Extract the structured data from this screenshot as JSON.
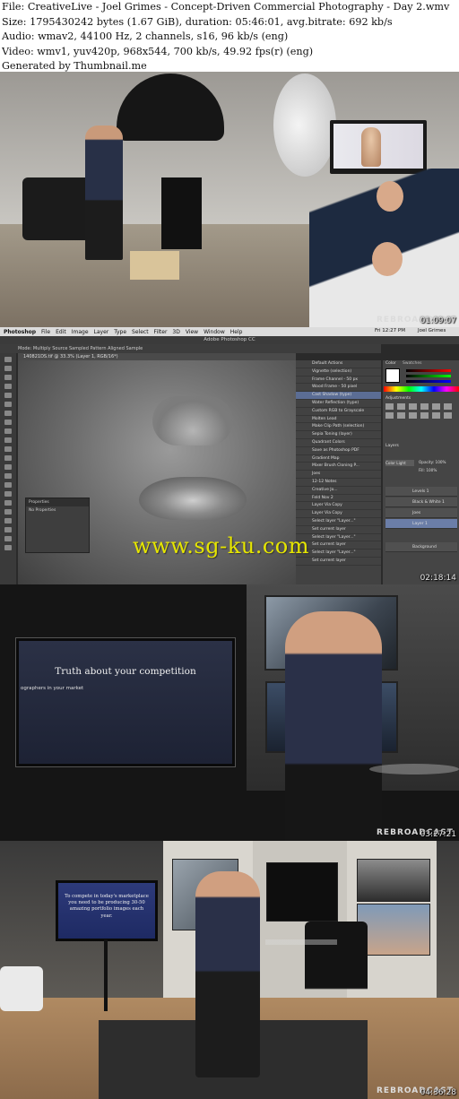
{
  "header": {
    "file_line": "File: CreativeLive - Joel Grimes - Concept-Driven Commercial Photography - Day 2.wmv",
    "size_line": "Size: 1795430242 bytes (1.67 GiB), duration: 05:46:01, avg.bitrate: 692 kb/s",
    "audio_line": "Audio: wmav2, 44100 Hz, 2 channels, s16, 96 kb/s (eng)",
    "video_line": "Video: wmv1, yuv420p, 968x544, 700 kb/s, 49.92 fps(r) (eng)",
    "generated_line": "Generated by Thumbnail.me"
  },
  "frames": [
    {
      "timestamp": "01:09:07",
      "watermark": "REBROADCAST"
    },
    {
      "timestamp": "02:18:14",
      "watermark": ""
    },
    {
      "timestamp": "03:27:21",
      "watermark": "REBROADCAST"
    },
    {
      "timestamp": "04:36:28",
      "watermark": "REBROADCAST"
    }
  ],
  "photoshop": {
    "menu": [
      "Photoshop",
      "File",
      "Edit",
      "Image",
      "Layer",
      "Type",
      "Select",
      "Filter",
      "3D",
      "View",
      "Window",
      "Help"
    ],
    "clock": "Fri 12:27 PM",
    "user": "Joel Grimes",
    "window_title": "Adobe Photoshop CC",
    "options_bar": "Mode: Multiply   Source   Sampled   Pattern   Aligned Sample",
    "doc_tab": "140821DS.tif @ 33.3% (Layer 1, RGB/16*)",
    "properties_title": "Properties",
    "properties_text": "No Properties",
    "actions": [
      "Default Actions",
      "Vignette (selection)",
      "Frame Channel - 50 px",
      "Wood Frame - 50 pixel",
      "Cast Shadow (type)",
      "Water Reflection (type)",
      "Custom RGB to Grayscale",
      "Molten Lead",
      "Make Clip Path (selection)",
      "Sepia Toning (layer)",
      "Quadrant Colors",
      "Save as Photoshop PDF",
      "Gradient Map",
      "Mixer Brush Cloning P...",
      "Joes",
      "12-12 Notes",
      "Creative Jo...",
      "Feld Nov 2",
      "Layer Via Copy",
      "Layer Via Copy",
      "Select layer \"Layer...\"",
      "Set current layer",
      "Select layer \"Layer...\"",
      "Set current layer",
      "Select layer \"Layer...\"",
      "Set current layer"
    ],
    "panels": [
      "Color",
      "Swatches",
      "Adjustments",
      "Layers"
    ],
    "layers": [
      "Levels 1",
      "Black & White 1",
      "Joes",
      "Layer 1",
      "Background"
    ],
    "layer_mode": "Color Light",
    "opacity": "Opacity: 100%",
    "fill": "Fill: 100%"
  },
  "site_watermark": "www.sg-ku.com",
  "slide1": {
    "title": "Truth about your competition",
    "line": "ographers in your market"
  },
  "slide2": {
    "text": "To compete in today's marketplace you need to be producing 30-50 amazing portfolio images each year."
  }
}
